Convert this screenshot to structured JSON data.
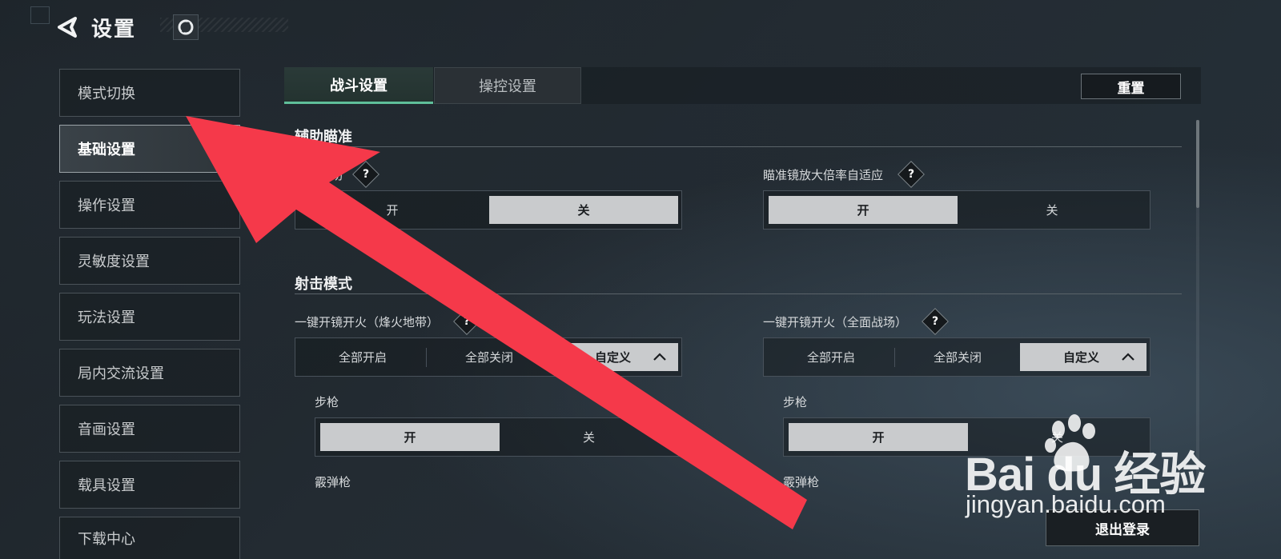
{
  "header": {
    "title": "设置"
  },
  "sidebar": {
    "items": [
      {
        "label": "模式切换"
      },
      {
        "label": "基础设置",
        "active": true
      },
      {
        "label": "操作设置"
      },
      {
        "label": "灵敏度设置"
      },
      {
        "label": "玩法设置"
      },
      {
        "label": "局内交流设置"
      },
      {
        "label": "音画设置"
      },
      {
        "label": "载具设置"
      },
      {
        "label": "下载中心"
      }
    ]
  },
  "tabs": [
    {
      "label": "战斗设置",
      "active": true
    },
    {
      "label": "操控设置"
    }
  ],
  "toolbar": {
    "reset_label": "重置",
    "logout_label": "退出登录"
  },
  "sections": {
    "aim": {
      "title": "辅助瞄准",
      "aim_assist": {
        "label": "瞄准辅助",
        "help": "?",
        "on": "开",
        "off": "关",
        "selected": "关"
      },
      "scope_adapt": {
        "label": "瞄准镜放大倍率自适应",
        "help": "?",
        "on": "开",
        "off": "关",
        "selected": "开"
      }
    },
    "fire": {
      "title": "射击模式",
      "left": {
        "label": "一键开镜开火（烽火地带）",
        "help": "?",
        "all_on": "全部开启",
        "all_off": "全部关闭",
        "custom": "自定义",
        "selected": "自定义",
        "rifle": {
          "label": "步枪",
          "on": "开",
          "off": "关",
          "selected": "开"
        },
        "shotgun": {
          "label": "霰弹枪"
        }
      },
      "right": {
        "label": "一键开镜开火（全面战场）",
        "help": "?",
        "all_on": "全部开启",
        "all_off": "全部关闭",
        "custom": "自定义",
        "selected": "自定义",
        "rifle": {
          "label": "步枪",
          "on": "开",
          "off": "关",
          "selected": "开"
        },
        "shotgun": {
          "label": "霰弹枪"
        }
      }
    }
  },
  "watermark": {
    "brand": "Bai du 经验",
    "url": "jingyan.baidu.com"
  },
  "colors": {
    "accent": "#5fbf9a",
    "selected_option": "#c9cbcd",
    "arrow": "#f5394a"
  }
}
